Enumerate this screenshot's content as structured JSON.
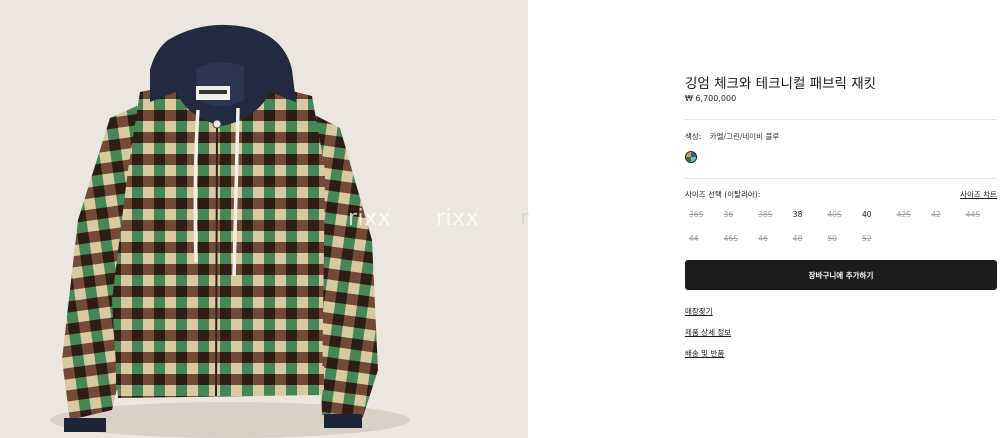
{
  "product": {
    "title": "깅엄 체크와 테크니컬 패브릭 재킷",
    "price": "₩ 6,700,000",
    "image_alt": "gingham check jacket with navy hood"
  },
  "color": {
    "label": "색상:",
    "value": "카멜/그린/네이비 블루",
    "swatch_icon": "multicolor-swatch-icon"
  },
  "size_selector": {
    "label": "사이즈 선택 (이탈리아):",
    "chart_link": "사이즈 차트",
    "sizes": [
      {
        "label": "36S",
        "available": false
      },
      {
        "label": "36",
        "available": false
      },
      {
        "label": "38S",
        "available": false
      },
      {
        "label": "38",
        "available": true
      },
      {
        "label": "40S",
        "available": false
      },
      {
        "label": "40",
        "available": true
      },
      {
        "label": "42S",
        "available": false
      },
      {
        "label": "42",
        "available": false
      },
      {
        "label": "44S",
        "available": false
      },
      {
        "label": "44",
        "available": false
      },
      {
        "label": "46S",
        "available": false
      },
      {
        "label": "46",
        "available": false
      },
      {
        "label": "48",
        "available": false
      },
      {
        "label": "50",
        "available": false
      },
      {
        "label": "52",
        "available": false
      }
    ]
  },
  "actions": {
    "add_to_cart": "장바구니에 추가하기"
  },
  "links": {
    "store_finder": "매장찾기",
    "product_details": "제품 상세 정보",
    "shipping_returns": "배송 및 반품"
  },
  "watermarks": [
    "rixx",
    "rixx",
    "r"
  ],
  "colors": {
    "button_bg": "#1c1c1c",
    "image_bg": "#ebe6df",
    "disabled_size": "#a3a3a3"
  }
}
